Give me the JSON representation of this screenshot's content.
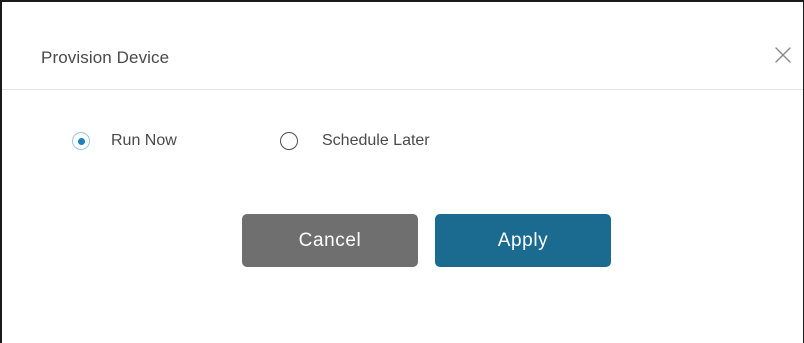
{
  "dialog": {
    "title": "Provision Device",
    "close_icon": "close-icon"
  },
  "options": {
    "run_now": {
      "label": "Run Now",
      "checked": true
    },
    "schedule_later": {
      "label": "Schedule Later",
      "checked": false
    }
  },
  "actions": {
    "cancel_label": "Cancel",
    "apply_label": "Apply"
  },
  "colors": {
    "apply": "#1b6a90",
    "cancel": "#6f6f6f",
    "radio_selected": "#1e7fbf"
  }
}
